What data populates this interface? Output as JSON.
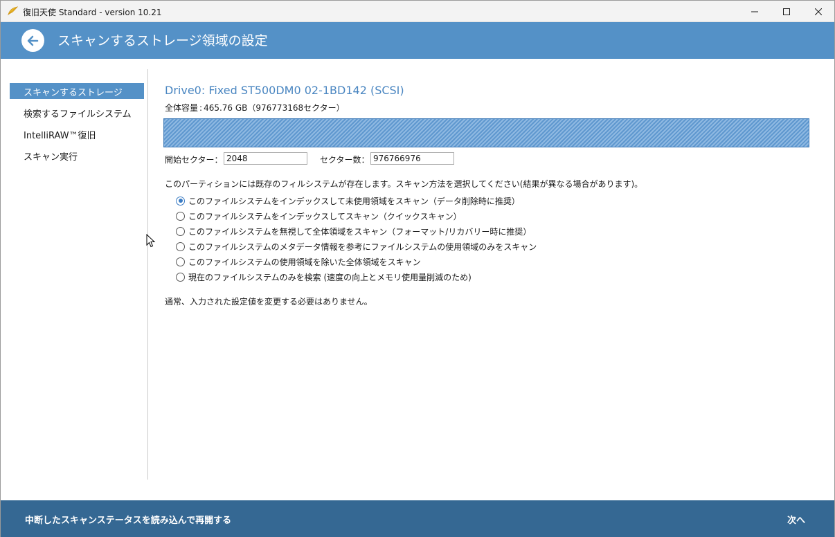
{
  "window": {
    "title": "復旧天使 Standard - version 10.21"
  },
  "header": {
    "title": "スキャンするストレージ領域の設定"
  },
  "sidebar": {
    "items": [
      {
        "label": "スキャンするストレージ",
        "active": true
      },
      {
        "label": "検索するファイルシステム",
        "active": false
      },
      {
        "label": "IntelliRAW™復旧",
        "active": false
      },
      {
        "label": "スキャン実行",
        "active": false
      }
    ]
  },
  "drive": {
    "title": "Drive0: Fixed ST500DM0 02-1BD142 (SCSI)",
    "capacity_label": "全体容量",
    "capacity_value": "465.76 GB（976773168セクター）"
  },
  "fields": {
    "start_sector_label": "開始セクター：",
    "start_sector_value": "2048",
    "sector_count_label": "セクター数：",
    "sector_count_value": "976766976"
  },
  "description": "このパーティションには既存のフィルシステムが存在します。スキャン方法を選択してください(結果が異なる場合があります)。",
  "options": [
    {
      "label": "このファイルシステムをインデックスして未使用領域をスキャン（データ削除時に推奨）",
      "checked": true
    },
    {
      "label": "このファイルシステムをインデックスしてスキャン（クイックスキャン）",
      "checked": false
    },
    {
      "label": "このファイルシステムを無視して全体領域をスキャン（フォーマット/リカバリー時に推奨）",
      "checked": false
    },
    {
      "label": "このファイルシステムのメタデータ情報を参考にファイルシステムの使用領域のみをスキャン",
      "checked": false
    },
    {
      "label": "このファイルシステムの使用領域を除いた全体領域をスキャン",
      "checked": false
    },
    {
      "label": "現在のファイルシステムのみを検索 (速度の向上とメモリ使用量削減のため)",
      "checked": false
    }
  ],
  "note": "通常、入力された設定値を変更する必要はありません。",
  "footer": {
    "resume_label": "中断したスキャンステータスを読み込んで再開する",
    "next_label": "次へ"
  },
  "colors": {
    "header": "#5491c7",
    "footer": "#356893",
    "accent_text": "#4a86c1"
  }
}
